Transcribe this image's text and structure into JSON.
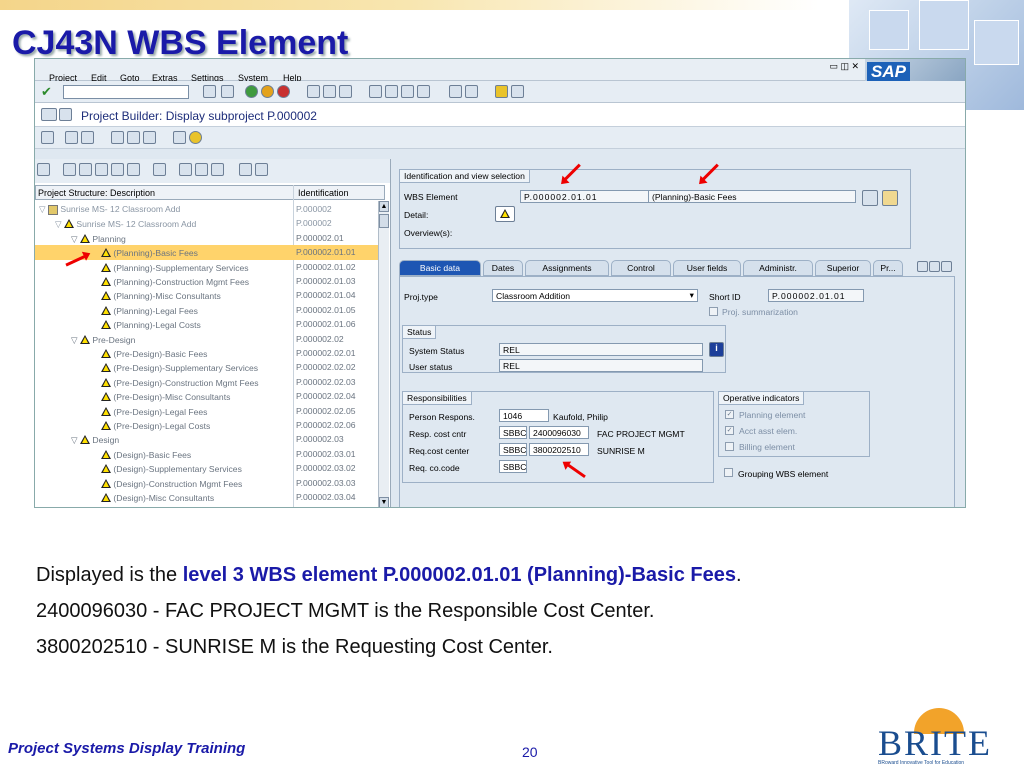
{
  "slide": {
    "title": "CJ43N WBS Element",
    "footer": "Project Systems Display Training",
    "page_number": "20",
    "logo": {
      "word": "BRITE",
      "tagline": "BRoward Innovative Tool for Education"
    }
  },
  "sap": {
    "menu": [
      "Project",
      "Edit",
      "Goto",
      "Extras",
      "Settings",
      "System",
      "Help"
    ],
    "screen_title": "Project Builder: Display subproject P.000002",
    "brand": "SAP",
    "tree": {
      "col_description": "Project Structure: Description",
      "col_identification": "Identification",
      "rows": [
        {
          "label": "Sunrise MS- 12 Classroom Add",
          "id": "P.000002"
        },
        {
          "label": "Sunrise MS- 12 Classroom Add",
          "id": "P.000002"
        },
        {
          "label": "Planning",
          "id": "P.000002.01"
        },
        {
          "label": "(Planning)-Basic Fees",
          "id": "P.000002.01.01"
        },
        {
          "label": "(Planning)-Supplementary Services",
          "id": "P.000002.01.02"
        },
        {
          "label": "(Planning)-Construction Mgmt Fees",
          "id": "P.000002.01.03"
        },
        {
          "label": "(Planning)-Misc Consultants",
          "id": "P.000002.01.04"
        },
        {
          "label": "(Planning)-Legal Fees",
          "id": "P.000002.01.05"
        },
        {
          "label": "(Planning)-Legal Costs",
          "id": "P.000002.01.06"
        },
        {
          "label": "Pre-Design",
          "id": "P.000002.02"
        },
        {
          "label": "(Pre-Design)-Basic Fees",
          "id": "P.000002.02.01"
        },
        {
          "label": "(Pre-Design)-Supplementary Services",
          "id": "P.000002.02.02"
        },
        {
          "label": "(Pre-Design)-Construction Mgmt Fees",
          "id": "P.000002.02.03"
        },
        {
          "label": "(Pre-Design)-Misc Consultants",
          "id": "P.000002.02.04"
        },
        {
          "label": "(Pre-Design)-Legal Fees",
          "id": "P.000002.02.05"
        },
        {
          "label": "(Pre-Design)-Legal Costs",
          "id": "P.000002.02.06"
        },
        {
          "label": "Design",
          "id": "P.000002.03"
        },
        {
          "label": "(Design)-Basic Fees",
          "id": "P.000002.03.01"
        },
        {
          "label": "(Design)-Supplementary Services",
          "id": "P.000002.03.02"
        },
        {
          "label": "(Design)-Construction Mgmt Fees",
          "id": "P.000002.03.03"
        },
        {
          "label": "(Design)-Misc Consultants",
          "id": "P.000002.03.04"
        }
      ]
    },
    "ident": {
      "group_title": "Identification and view selection",
      "wbs_label": "WBS Element",
      "wbs_value": "P.000002.01.01",
      "wbs_desc": "(Planning)-Basic Fees",
      "detail_label": "Detail:",
      "overview_label": "Overview(s):"
    },
    "tabs": [
      "Basic data",
      "Dates",
      "Assignments",
      "Control",
      "User fields",
      "Administr.",
      "Superior",
      "Pr..."
    ],
    "basic": {
      "projtype_label": "Proj.type",
      "projtype_value": "Classroom Addition",
      "shortid_label": "Short ID",
      "shortid_value": "P.000002.01.01",
      "proj_summ_label": "Proj. summarization",
      "status_title": "Status",
      "system_status_label": "System Status",
      "system_status_value": "REL",
      "user_status_label": "User status",
      "user_status_value": "REL",
      "resp_title": "Responsibilities",
      "person_label": "Person Respons.",
      "person_value": "1046",
      "person_name": "Kaufold, Philip",
      "respcc_label": "Resp. cost cntr",
      "respcc_co": "SBBC",
      "respcc_value": "2400096030",
      "respcc_name": "FAC PROJECT MGMT",
      "reqcc_label": "Req.cost center",
      "reqcc_co": "SBBC",
      "reqcc_value": "3800202510",
      "reqcc_name": "SUNRISE M",
      "reqco_label": "Req. co.code",
      "reqco_value": "SBBC",
      "op_title": "Operative indicators",
      "planning_element": "Planning element",
      "acct_asst": "Acct asst elem.",
      "billing": "Billing element",
      "grouping": "Grouping WBS element"
    }
  },
  "caption": {
    "line1_pre": "Displayed is the ",
    "line1_hl": "level  3 WBS element P.000002.01.01 (Planning)-Basic Fees",
    "line1_post": ".",
    "line2": "2400096030 - FAC PROJECT MGMT is the Responsible Cost Center.",
    "line3": "3800202510 - SUNRISE M is the Requesting Cost Center."
  }
}
